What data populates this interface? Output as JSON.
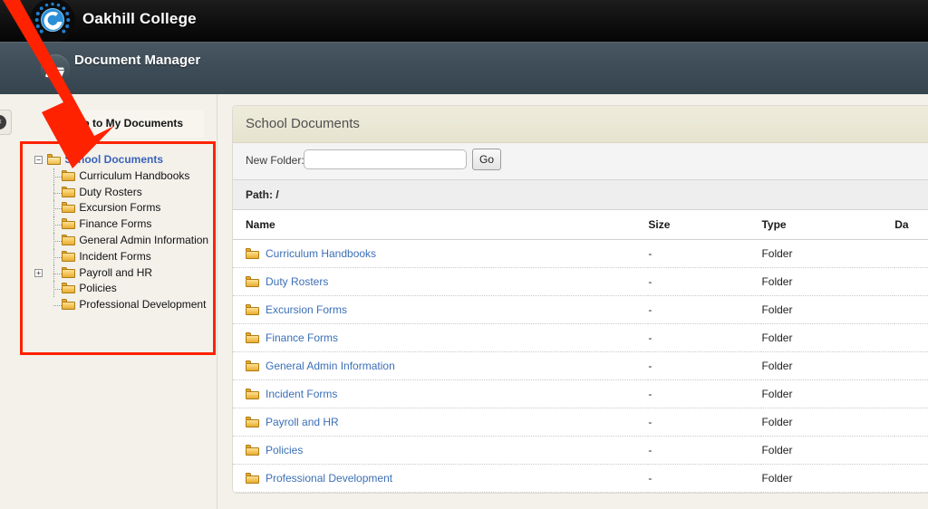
{
  "brand": {
    "title": "Oakhill College",
    "logo_icon": "circular-swirl-logo-icon"
  },
  "module": {
    "title": "Document Manager",
    "icon": "folder-icon"
  },
  "sidebar": {
    "collapse_tab": {
      "icon": "collapse-left-icon",
      "glyph": "«"
    },
    "my_documents": {
      "label": "Go to My Documents",
      "icon": "green-right-arrow-icon"
    },
    "tree": {
      "root": {
        "label": "School Documents",
        "expander": "−",
        "icon": "open-folder-icon"
      },
      "children": [
        {
          "label": "Curriculum Handbooks",
          "expander": "",
          "icon": "folder-icon"
        },
        {
          "label": "Duty Rosters",
          "expander": "",
          "icon": "folder-icon"
        },
        {
          "label": "Excursion Forms",
          "expander": "",
          "icon": "folder-icon"
        },
        {
          "label": "Finance Forms",
          "expander": "",
          "icon": "folder-icon"
        },
        {
          "label": "General Admin Information",
          "expander": "",
          "icon": "folder-icon"
        },
        {
          "label": "Incident Forms",
          "expander": "",
          "icon": "folder-icon"
        },
        {
          "label": "Payroll and HR",
          "expander": "+",
          "icon": "folder-icon"
        },
        {
          "label": "Policies",
          "expander": "",
          "icon": "folder-icon"
        },
        {
          "label": "Professional Development",
          "expander": "",
          "icon": "folder-icon"
        }
      ]
    }
  },
  "panel": {
    "title": "School Documents",
    "toolbar": {
      "new_folder_label": "New Folder:",
      "new_folder_value": "",
      "new_folder_placeholder": "",
      "go_label": "Go"
    },
    "path": "Path: /",
    "table": {
      "columns": [
        "Name",
        "Size",
        "Type",
        "Da"
      ],
      "rows": [
        {
          "name": "Curriculum Handbooks",
          "size": "-",
          "type": "Folder",
          "date": ""
        },
        {
          "name": "Duty Rosters",
          "size": "-",
          "type": "Folder",
          "date": ""
        },
        {
          "name": "Excursion Forms",
          "size": "-",
          "type": "Folder",
          "date": ""
        },
        {
          "name": "Finance Forms",
          "size": "-",
          "type": "Folder",
          "date": ""
        },
        {
          "name": "General Admin Information",
          "size": "-",
          "type": "Folder",
          "date": ""
        },
        {
          "name": "Incident Forms",
          "size": "-",
          "type": "Folder",
          "date": ""
        },
        {
          "name": "Payroll and HR",
          "size": "-",
          "type": "Folder",
          "date": ""
        },
        {
          "name": "Policies",
          "size": "-",
          "type": "Folder",
          "date": ""
        },
        {
          "name": "Professional Development",
          "size": "-",
          "type": "Folder",
          "date": ""
        }
      ]
    }
  },
  "annotations": {
    "arrow_color": "#ff2200",
    "highlight_box_color": "#ff2200"
  },
  "colors": {
    "brand_bar": "#0d0d0d",
    "module_bar": "#3c4a55",
    "panel_header": "#e8e6d4",
    "link": "#3b6fb6",
    "tree_root_link": "#3a63b8",
    "folder": "#f2c45a",
    "page_background": "#f3f1ea"
  }
}
